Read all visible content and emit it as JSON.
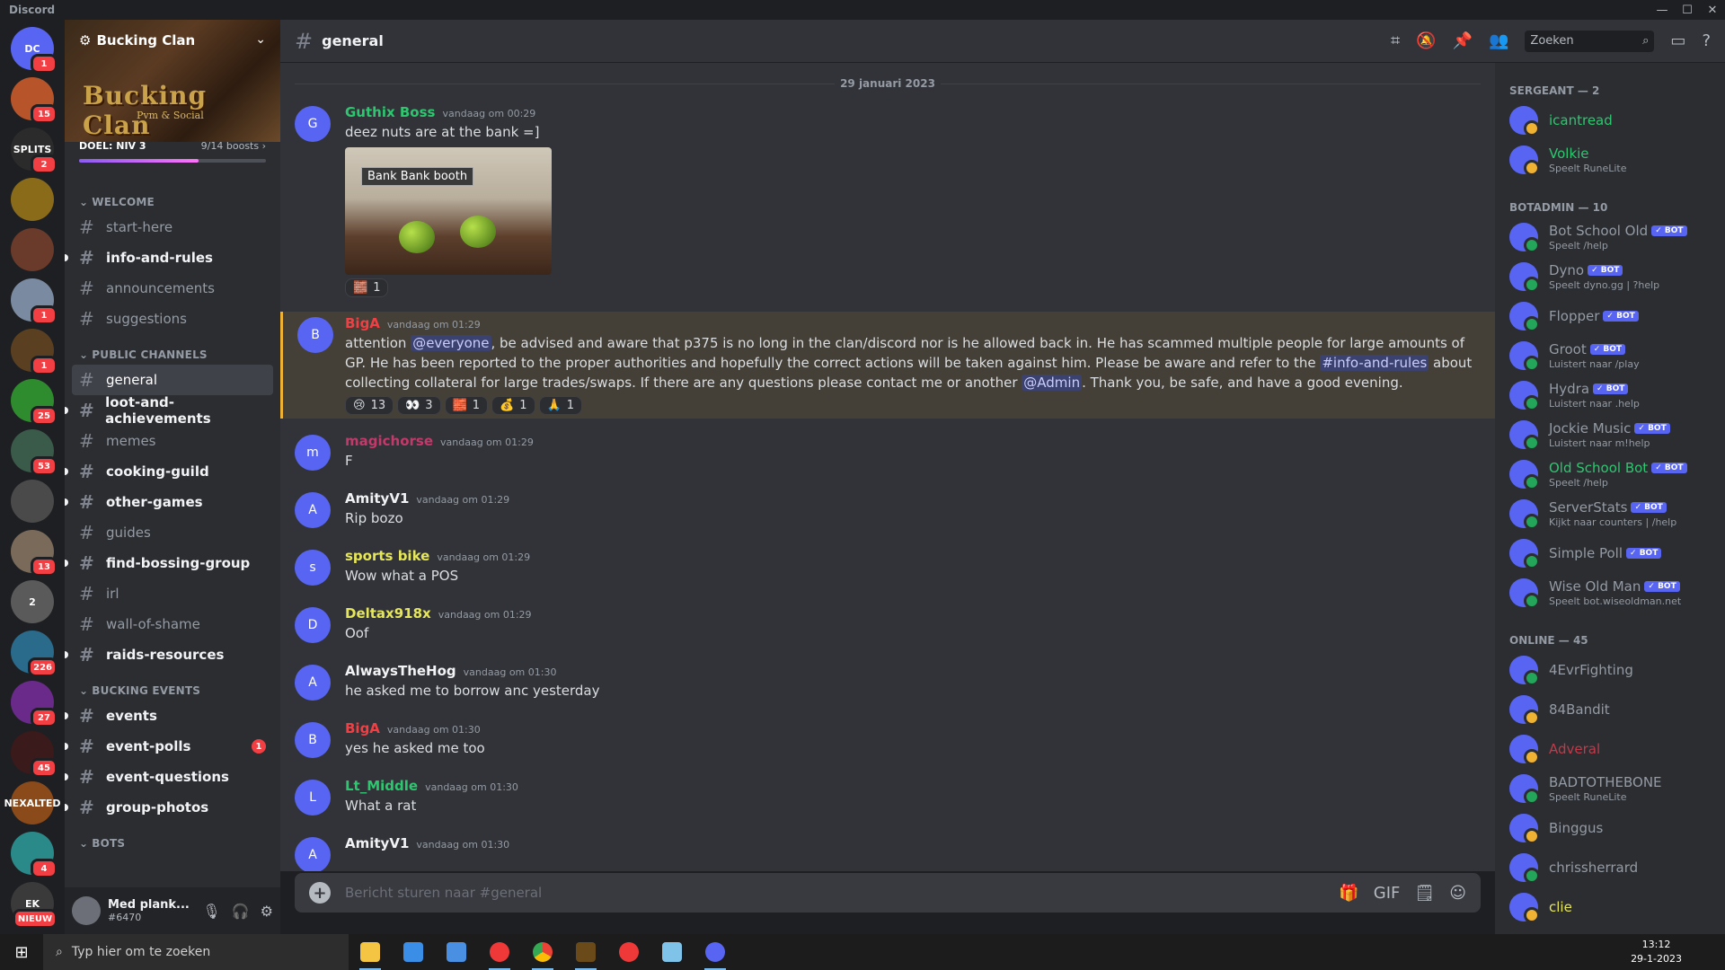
{
  "window": {
    "app_name": "Discord",
    "controls": [
      "—",
      "☐",
      "✕"
    ]
  },
  "rail": {
    "servers": [
      {
        "label": "DC",
        "badge": "1",
        "color": "#5865f2"
      },
      {
        "label": "",
        "badge": "15",
        "color": "#b8542a"
      },
      {
        "label": "SPLITS",
        "badge": "2",
        "color": "#2b2b2b"
      },
      {
        "label": "",
        "badge": "",
        "color": "#8a6b1a"
      },
      {
        "label": "",
        "badge": "",
        "color": "#6a3a2a"
      },
      {
        "label": "",
        "badge": "1",
        "color": "#7a8aa0"
      },
      {
        "label": "",
        "badge": "1",
        "color": "#5a4020"
      },
      {
        "label": "",
        "badge": "25",
        "color": "#2e8b2e"
      },
      {
        "label": "",
        "badge": "53",
        "color": "#3a5a4a"
      },
      {
        "label": "",
        "badge": "",
        "color": "#4a4a4a"
      },
      {
        "label": "",
        "badge": "13",
        "color": "#7a6a5a"
      },
      {
        "label": "2",
        "badge": "",
        "color": "#5a5a5a"
      },
      {
        "label": "",
        "badge": "226",
        "color": "#2a6a8a"
      },
      {
        "label": "",
        "badge": "27",
        "color": "#6a2a8a"
      },
      {
        "label": "",
        "badge": "45",
        "color": "#3a1a1a"
      },
      {
        "label": "NEXALTED",
        "badge": "",
        "color": "#8a4a1a"
      },
      {
        "label": "",
        "badge": "4",
        "color": "#2a8a8a"
      },
      {
        "label": "EK",
        "badge": "NIEUW",
        "color": "#3a3a3a"
      }
    ]
  },
  "server": {
    "name": "Bucking Clan",
    "banner_logo": "Bucking Clan",
    "banner_sub": "Pvm & Social",
    "boost_goal": "DOEL: NIV 3",
    "boost_count": "9/14 boosts",
    "boost_progress": 0.64
  },
  "categories": [
    {
      "name": "WELCOME",
      "channels": [
        {
          "name": "start-here",
          "unread": false
        },
        {
          "name": "info-and-rules",
          "unread": true
        },
        {
          "name": "announcements",
          "unread": false
        },
        {
          "name": "suggestions",
          "unread": false
        }
      ]
    },
    {
      "name": "PUBLIC CHANNELS",
      "channels": [
        {
          "name": "general",
          "unread": false,
          "active": true
        },
        {
          "name": "loot-and-achievements",
          "unread": true
        },
        {
          "name": "memes",
          "unread": false
        },
        {
          "name": "cooking-guild",
          "unread": true
        },
        {
          "name": "other-games",
          "unread": true
        },
        {
          "name": "guides",
          "unread": false
        },
        {
          "name": "find-bossing-group",
          "unread": true
        },
        {
          "name": "irl",
          "unread": false
        },
        {
          "name": "wall-of-shame",
          "unread": false
        },
        {
          "name": "raids-resources",
          "unread": true
        }
      ]
    },
    {
      "name": "BUCKING EVENTS",
      "channels": [
        {
          "name": "events",
          "unread": true
        },
        {
          "name": "event-polls",
          "unread": true,
          "mentions": "1"
        },
        {
          "name": "event-questions",
          "unread": true
        },
        {
          "name": "group-photos",
          "unread": true
        }
      ]
    },
    {
      "name": "BOTS",
      "channels": []
    }
  ],
  "user": {
    "name": "Med plank...",
    "tag": "#6470"
  },
  "header": {
    "channel": "general",
    "search_placeholder": "Zoeken"
  },
  "chat": {
    "date_divider": "29 januari 2023",
    "messages": [
      {
        "author": "Guthix Boss",
        "color": "#2dc770",
        "time": "vandaag om 00:29",
        "text": "deez nuts are at the bank =]",
        "attachment_label": "Bank Bank booth",
        "reactions": [
          {
            "emoji": "🧱",
            "count": "1"
          }
        ]
      },
      {
        "author": "BigA",
        "color": "#f23f43",
        "time": "vandaag om 01:29",
        "highlight": true,
        "parts": [
          "attention ",
          "@everyone",
          ", be advised and aware that p375 is no long in the clan/discord nor is he allowed back in. He has scammed multiple people for large amounts of GP. He has been reported to the proper authorities and hopefully the correct actions will be taken against him. Please be aware and refer to the ",
          "#info-and-rules",
          " about collecting collateral for large trades/swaps. If there are any questions please contact me or another ",
          "@Admin",
          ". Thank you, be safe, and have a good evening."
        ],
        "reactions": [
          {
            "emoji": "😢",
            "count": "13"
          },
          {
            "emoji": "👀",
            "count": "3"
          },
          {
            "emoji": "🧱",
            "count": "1"
          },
          {
            "emoji": "💰",
            "count": "1"
          },
          {
            "emoji": "🙏",
            "count": "1"
          }
        ]
      },
      {
        "author": "magichorse",
        "color": "#c23a6a",
        "time": "vandaag om 01:29",
        "text": "F"
      },
      {
        "author": "AmityV1",
        "color": "#f2f3f5",
        "time": "vandaag om 01:29",
        "text": "Rip bozo"
      },
      {
        "author": "sports bike",
        "color": "#e6e65a",
        "time": "vandaag om 01:29",
        "text": "Wow what a POS"
      },
      {
        "author": "Deltax918x",
        "color": "#e6e65a",
        "time": "vandaag om 01:29",
        "text": "Oof"
      },
      {
        "author": "AlwaysTheHog",
        "color": "#f2f3f5",
        "time": "vandaag om 01:30",
        "text": "he asked me to borrow anc yesterday"
      },
      {
        "author": "BigA",
        "color": "#f23f43",
        "time": "vandaag om 01:30",
        "text": "yes he asked me too"
      },
      {
        "author": "Lt_Middle",
        "color": "#2dc770",
        "time": "vandaag om 01:30",
        "text": "What a rat"
      },
      {
        "author": "AmityV1",
        "color": "#f2f3f5",
        "time": "vandaag om 01:30",
        "text": ""
      }
    ],
    "composer_placeholder": "Bericht sturen naar #general"
  },
  "members": {
    "groups": [
      {
        "title": "SERGEANT — 2",
        "items": [
          {
            "name": "icantread",
            "color": "#2dc770",
            "status": "",
            "bot": false,
            "presence": "#f0b232"
          },
          {
            "name": "Volkie",
            "color": "#2dc770",
            "status": "Speelt RuneLite",
            "bot": false,
            "presence": "#f0b232"
          }
        ]
      },
      {
        "title": "BOTADMIN — 10",
        "items": [
          {
            "name": "Bot School Old",
            "color": "#949ba4",
            "status": "Speelt /help",
            "bot": true,
            "presence": "#23a55a"
          },
          {
            "name": "Dyno",
            "color": "#949ba4",
            "status": "Speelt dyno.gg | ?help",
            "bot": true,
            "presence": "#23a55a"
          },
          {
            "name": "Flopper",
            "color": "#949ba4",
            "status": "",
            "bot": true,
            "presence": "#23a55a"
          },
          {
            "name": "Groot",
            "color": "#949ba4",
            "status": "Luistert naar /play",
            "bot": true,
            "presence": "#23a55a"
          },
          {
            "name": "Hydra",
            "color": "#949ba4",
            "status": "Luistert naar .help",
            "bot": true,
            "presence": "#23a55a"
          },
          {
            "name": "Jockie Music",
            "color": "#949ba4",
            "status": "Luistert naar m!help",
            "bot": true,
            "presence": "#23a55a"
          },
          {
            "name": "Old School Bot",
            "color": "#2dc770",
            "status": "Speelt /help",
            "bot": true,
            "presence": "#23a55a"
          },
          {
            "name": "ServerStats",
            "color": "#949ba4",
            "status": "Kijkt naar counters | /help",
            "bot": true,
            "presence": "#23a55a"
          },
          {
            "name": "Simple Poll",
            "color": "#949ba4",
            "status": "",
            "bot": true,
            "presence": "#23a55a"
          },
          {
            "name": "Wise Old Man",
            "color": "#949ba4",
            "status": "Speelt bot.wiseoldman.net",
            "bot": true,
            "presence": "#23a55a"
          }
        ]
      },
      {
        "title": "ONLINE — 45",
        "items": [
          {
            "name": "4EvrFighting",
            "color": "#949ba4",
            "status": "",
            "bot": false,
            "presence": "#23a55a"
          },
          {
            "name": "84Bandit",
            "color": "#949ba4",
            "status": "",
            "bot": false,
            "presence": "#f0b232"
          },
          {
            "name": "Adveral",
            "color": "#c23a4a",
            "status": "",
            "bot": false,
            "presence": "#f0b232"
          },
          {
            "name": "BADTOTHEBONE",
            "color": "#949ba4",
            "status": "Speelt RuneLite",
            "bot": false,
            "presence": "#23a55a"
          },
          {
            "name": "Binggus",
            "color": "#949ba4",
            "status": "",
            "bot": false,
            "presence": "#f0b232"
          },
          {
            "name": "chrissherrard",
            "color": "#949ba4",
            "status": "",
            "bot": false,
            "presence": "#23a55a"
          },
          {
            "name": "clie",
            "color": "#e6e65a",
            "status": "",
            "bot": false,
            "presence": "#f0b232"
          }
        ]
      }
    ]
  },
  "taskbar": {
    "search_placeholder": "Typ hier om te zoeken",
    "time": "13:12",
    "date": "29-1-2023"
  },
  "colors": {
    "accent": "#5865f2",
    "danger": "#f23f43",
    "online": "#23a55a",
    "idle": "#f0b232"
  }
}
